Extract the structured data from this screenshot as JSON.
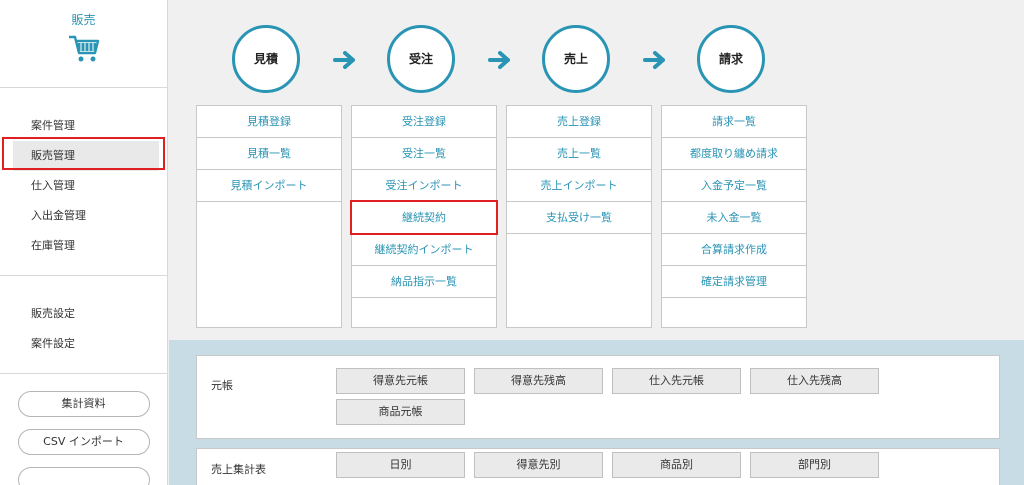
{
  "sidebar": {
    "title": "販売",
    "icon": "cart-icon",
    "main_items": [
      {
        "label": "案件管理"
      },
      {
        "label": "販売管理",
        "selected": true
      },
      {
        "label": "仕入管理"
      },
      {
        "label": "入出金管理"
      },
      {
        "label": "在庫管理"
      }
    ],
    "settings_items": [
      {
        "label": "販売設定"
      },
      {
        "label": "案件設定"
      }
    ],
    "buttons": [
      {
        "label": "集計資料"
      },
      {
        "label": "CSV インポート"
      },
      {
        "label": ""
      }
    ]
  },
  "flow": {
    "steps": [
      {
        "label": "見積",
        "items": [
          "見積登録",
          "見積一覧",
          "見積インポート"
        ]
      },
      {
        "label": "受注",
        "items": [
          "受注登録",
          "受注一覧",
          "受注インポート",
          "継続契約",
          "継続契約インポート",
          "納品指示一覧"
        ],
        "highlighted_item": "継続契約"
      },
      {
        "label": "売上",
        "items": [
          "売上登録",
          "売上一覧",
          "売上インポート",
          "支払受け一覧"
        ]
      },
      {
        "label": "請求",
        "items": [
          "請求一覧",
          "都度取り纏め請求",
          "入金予定一覧",
          "未入金一覧",
          "合算請求作成",
          "確定請求管理"
        ]
      }
    ]
  },
  "reports": {
    "ledger": {
      "label": "元帳",
      "buttons": [
        "得意先元帳",
        "得意先残高",
        "仕入先元帳",
        "仕入先残高",
        "商品元帳"
      ]
    },
    "sales_summary": {
      "label": "売上集計表",
      "buttons": [
        "日別",
        "得意先別",
        "商品別",
        "部門別"
      ]
    }
  },
  "colors": {
    "accent": "#2a94b4",
    "highlight": "#e02020",
    "reports_bg": "#c7dce5"
  }
}
